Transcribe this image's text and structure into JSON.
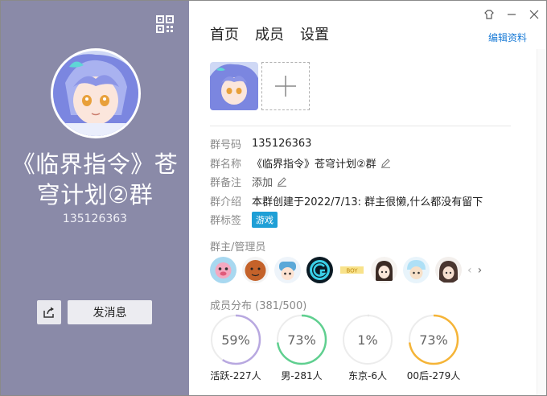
{
  "window": {
    "left": {
      "group_name": "《临界指令》苍穹计划②群",
      "group_id": "135126363",
      "send_button": "发消息"
    },
    "tabs": [
      {
        "label": "首页"
      },
      {
        "label": "成员"
      },
      {
        "label": "设置"
      }
    ],
    "edit_link": "编辑资料",
    "info": {
      "number_label": "群号码",
      "number_value": "135126363",
      "name_label": "群名称",
      "name_value": "《临界指令》苍穹计划②群",
      "remark_label": "群备注",
      "remark_value": "添加",
      "intro_label": "群介绍",
      "intro_value": "本群创建于2022/7/13:  群主很懒,什么都没有留下",
      "tag_label": "群标签",
      "tag_value": "游戏"
    },
    "admin_title": "群主/管理员",
    "admin_count": 8,
    "distribution": {
      "title": "成员分布 (381/500)",
      "items": [
        {
          "pct": "59%",
          "label": "活跃-227人",
          "value": 0.59,
          "color": "#b8a8e0"
        },
        {
          "pct": "73%",
          "label": "男-281人",
          "value": 0.73,
          "color": "#5fcf8f"
        },
        {
          "pct": "1%",
          "label": "东京-6人",
          "value": 0.01,
          "color": "#e6e6e6"
        },
        {
          "pct": "73%",
          "label": "00后-279人",
          "value": 0.73,
          "color": "#f5b437"
        }
      ]
    }
  }
}
